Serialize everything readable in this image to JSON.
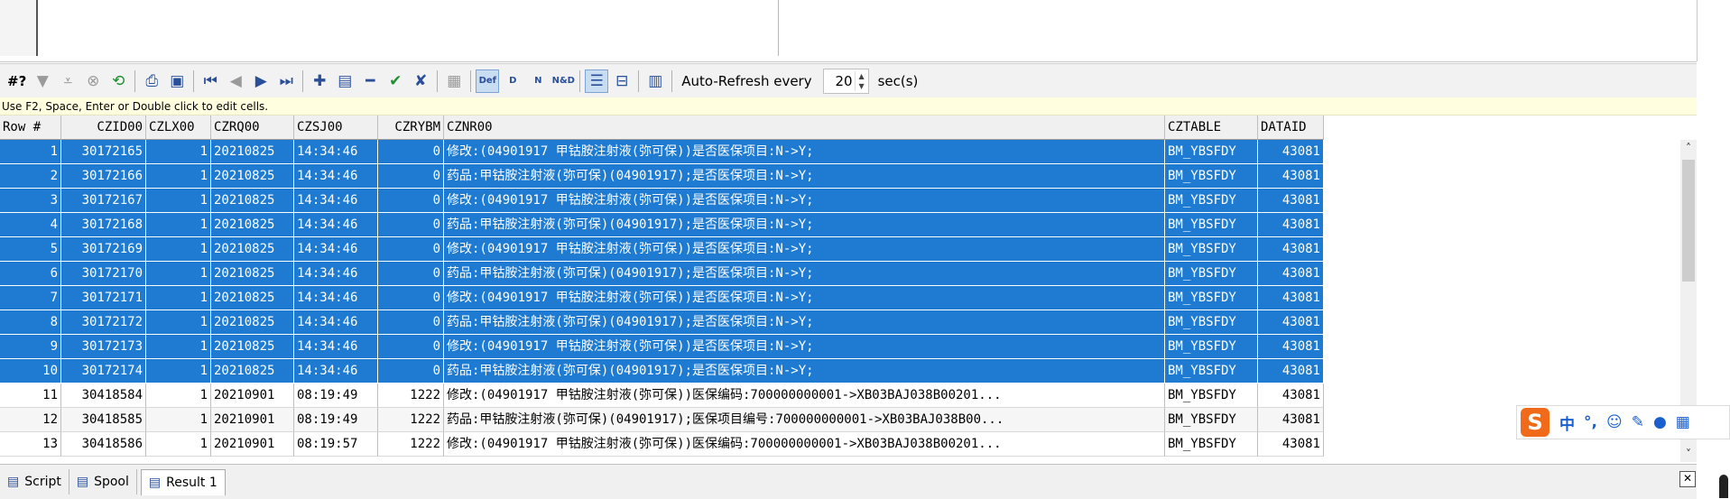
{
  "toolbar": {
    "hash_label": "#?",
    "refresh_label": "Auto-Refresh every",
    "refresh_value": "20",
    "refresh_unit": "sec(s)",
    "def_label": "Def",
    "d_label": "D",
    "n_label": "N",
    "nd_label": "N&D"
  },
  "hint": "Use F2, Space, Enter or Double click to edit cells.",
  "grid": {
    "columns": [
      "Row #",
      "CZID00",
      "CZLX00",
      "CZRQ00",
      "CZSJ00",
      "CZRYBM",
      "CZNR00",
      "CZTABLE",
      "DATAID"
    ],
    "rows": [
      [
        "1",
        "30172165",
        "1",
        "20210825",
        "14:34:46",
        "0",
        "修改:(04901917  甲钴胺注射液(弥可保))是否医保项目:N->Y;",
        "BM_YBSFDY",
        "43081"
      ],
      [
        "2",
        "30172166",
        "1",
        "20210825",
        "14:34:46",
        "0",
        "药品:甲钴胺注射液(弥可保)(04901917);是否医保项目:N->Y;",
        "BM_YBSFDY",
        "43081"
      ],
      [
        "3",
        "30172167",
        "1",
        "20210825",
        "14:34:46",
        "0",
        "修改:(04901917  甲钴胺注射液(弥可保))是否医保项目:N->Y;",
        "BM_YBSFDY",
        "43081"
      ],
      [
        "4",
        "30172168",
        "1",
        "20210825",
        "14:34:46",
        "0",
        "药品:甲钴胺注射液(弥可保)(04901917);是否医保项目:N->Y;",
        "BM_YBSFDY",
        "43081"
      ],
      [
        "5",
        "30172169",
        "1",
        "20210825",
        "14:34:46",
        "0",
        "修改:(04901917  甲钴胺注射液(弥可保))是否医保项目:N->Y;",
        "BM_YBSFDY",
        "43081"
      ],
      [
        "6",
        "30172170",
        "1",
        "20210825",
        "14:34:46",
        "0",
        "药品:甲钴胺注射液(弥可保)(04901917);是否医保项目:N->Y;",
        "BM_YBSFDY",
        "43081"
      ],
      [
        "7",
        "30172171",
        "1",
        "20210825",
        "14:34:46",
        "0",
        "修改:(04901917  甲钴胺注射液(弥可保))是否医保项目:N->Y;",
        "BM_YBSFDY",
        "43081"
      ],
      [
        "8",
        "30172172",
        "1",
        "20210825",
        "14:34:46",
        "0",
        "药品:甲钴胺注射液(弥可保)(04901917);是否医保项目:N->Y;",
        "BM_YBSFDY",
        "43081"
      ],
      [
        "9",
        "30172173",
        "1",
        "20210825",
        "14:34:46",
        "0",
        "修改:(04901917  甲钴胺注射液(弥可保))是否医保项目:N->Y;",
        "BM_YBSFDY",
        "43081"
      ],
      [
        "10",
        "30172174",
        "1",
        "20210825",
        "14:34:46",
        "0",
        "药品:甲钴胺注射液(弥可保)(04901917);是否医保项目:N->Y;",
        "BM_YBSFDY",
        "43081"
      ],
      [
        "11",
        "30418584",
        "1",
        "20210901",
        "08:19:49",
        "1222",
        "修改:(04901917  甲钴胺注射液(弥可保))医保编码:700000000001->XB03BAJ038B00201...",
        "BM_YBSFDY",
        "43081"
      ],
      [
        "12",
        "30418585",
        "1",
        "20210901",
        "08:19:49",
        "1222",
        "药品:甲钴胺注射液(弥可保)(04901917);医保项目编号:700000000001->XB03BAJ038B00...",
        "BM_YBSFDY",
        "43081"
      ],
      [
        "13",
        "30418586",
        "1",
        "20210901",
        "08:19:57",
        "1222",
        "修改:(04901917  甲钴胺注射液(弥可保))医保编码:700000000001->XB03BAJ038B00201...",
        "BM_YBSFDY",
        "43081"
      ]
    ],
    "selected_rows": 10
  },
  "ime": {
    "logo": "S",
    "lang": "中",
    "punct": "°,",
    "emoji": "☺",
    "pen": "✎",
    "mic": "🎤",
    "grid": "▦"
  },
  "bottom_tabs": [
    {
      "label": "Script",
      "icon": "sql-script-icon"
    },
    {
      "label": "Spool",
      "icon": "spool-icon"
    },
    {
      "label": "Result 1",
      "icon": "result-icon"
    }
  ],
  "colors": {
    "selection": "#1e7bd1",
    "hint_bg": "#ffffe0"
  }
}
